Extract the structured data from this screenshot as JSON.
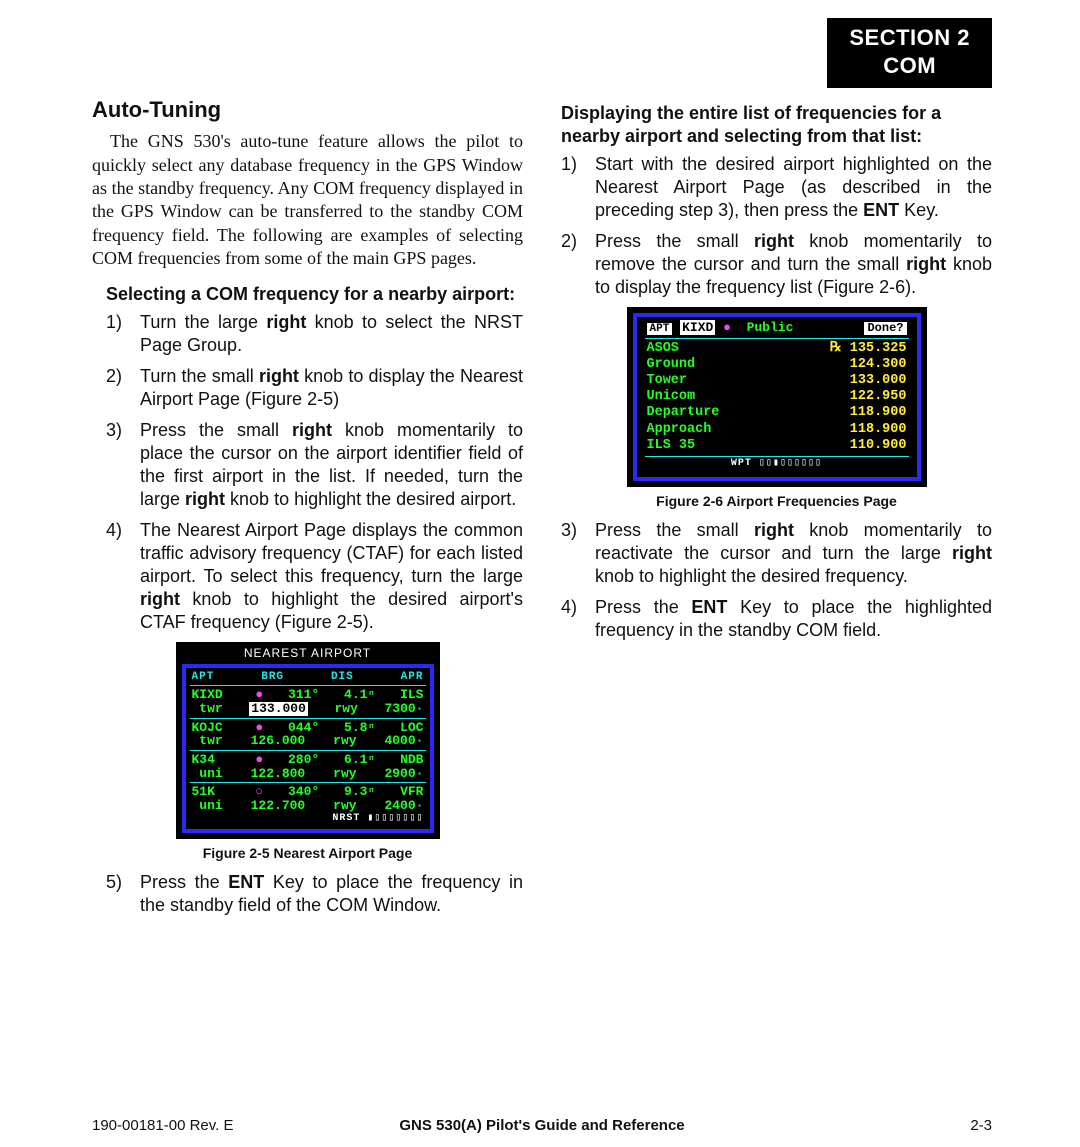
{
  "sectionTab": {
    "line1": "SECTION 2",
    "line2": "COM"
  },
  "col1": {
    "title": "Auto-Tuning",
    "intro": "The GNS 530's auto-tune feature allows the pilot to quickly select any database frequency in the GPS Window as the standby frequency.  Any COM frequency displayed in the GPS Window can be transferred to the standby COM frequency field.  The following are examples of selecting COM frequencies from some of the main GPS pages.",
    "subhead": "Selecting a COM frequency for a nearby airport:",
    "steps": [
      {
        "n": "1)",
        "pre": "Turn the large ",
        "b": "right",
        "post": " knob to select the NRST Page Group."
      },
      {
        "n": "2)",
        "pre": "Turn the small ",
        "b": "right",
        "post": " knob to display the Nearest Airport Page (Figure 2-5)"
      },
      {
        "n": "3)",
        "pre": "Press the small ",
        "b": "right",
        "post": " knob momentarily to place the cursor on the airport identifier field of the first airport in the list.  If needed, turn the large ",
        "b2": "right",
        "post2": " knob to highlight the desired airport."
      },
      {
        "n": "4)",
        "pre": "The Nearest Airport Page displays the common traffic advisory frequency (CTAF) for each listed airport.  To select this frequency, turn the large ",
        "b": "right",
        "post": " knob to highlight the desired airport's CTAF frequency (Figure 2-5)."
      }
    ],
    "step5": {
      "n": "5)",
      "pre": "Press the ",
      "b": "ENT",
      "post": " Key to place the frequency in the standby field of the COM Window."
    }
  },
  "fig1": {
    "title": "NEAREST AIRPORT",
    "headers": [
      "APT",
      "BRG",
      "DIS",
      "APR"
    ],
    "rows": [
      {
        "apt": "KIXD",
        "sym": "●",
        "brg": "311°",
        "dis": "4.1ⁿ",
        "apr": "ILS",
        "lbl": "twr",
        "freqSel": "133.000",
        "rwy": "rwy",
        "rv": "7300·"
      },
      {
        "apt": "KOJC",
        "sym": "●",
        "brg": "044°",
        "dis": "5.8ⁿ",
        "apr": "LOC",
        "lbl": "twr",
        "freq": "126.000",
        "rwy": "rwy",
        "rv": "4000·"
      },
      {
        "apt": "K34",
        "sym": "●",
        "brg": "280°",
        "dis": "6.1ⁿ",
        "apr": "NDB",
        "lbl": "uni",
        "freq": "122.800",
        "rwy": "rwy",
        "rv": "2900·"
      },
      {
        "apt": "51K",
        "sym": "○",
        "brg": "340°",
        "dis": "9.3ⁿ",
        "apr": "VFR",
        "lbl": "uni",
        "freq": "122.700",
        "rwy": "rwy",
        "rv": "2400·"
      }
    ],
    "footer": "NRST ▮▯▯▯▯▯▯▯",
    "caption": "Figure 2-5  Nearest Airport Page"
  },
  "col2": {
    "subhead": "Displaying the entire list of frequencies for a nearby airport and selecting from that list:",
    "stepsA": [
      {
        "n": "1)",
        "pre": "Start with the desired airport highlighted on the Nearest Airport Page (as described in the preceding step 3), then press the ",
        "b": "ENT",
        "post": " Key."
      },
      {
        "n": "2)",
        "pre": "Press the small ",
        "b": "right",
        "post": " knob momentarily to remove the cursor and turn the small ",
        "b2": "right",
        "post2": " knob to display the frequency list (Figure 2-6)."
      }
    ],
    "stepsB": [
      {
        "n": "3)",
        "pre": "Press the small ",
        "b": "right",
        "post": " knob momentarily to reactivate the cursor and turn the large ",
        "b2": "right",
        "post2": " knob to highlight the desired frequency."
      },
      {
        "n": "4)",
        "pre": "Press the ",
        "b": "ENT",
        "post": " Key to place the highlighted frequency in the standby COM field."
      }
    ]
  },
  "fig2": {
    "aptLabel": "APT",
    "ident": "KIXD",
    "sym": "●",
    "type": "Public",
    "done": "Done?",
    "rows": [
      {
        "lab": "ASOS",
        "rx": "℞",
        "val": "135.325"
      },
      {
        "lab": "Ground",
        "val": "124.300"
      },
      {
        "lab": "Tower",
        "val": "133.000"
      },
      {
        "lab": "Unicom",
        "val": "122.950"
      },
      {
        "lab": "Departure",
        "val": "118.900"
      },
      {
        "lab": "Approach",
        "val": "118.900"
      },
      {
        "lab": "ILS 35",
        "val": "110.900"
      }
    ],
    "footer": "WPT ▯▯▮▯▯▯▯▯▯",
    "caption": "Figure 2-6  Airport Frequencies Page"
  },
  "footer": {
    "left": "190-00181-00  Rev. E",
    "center": "GNS 530(A) Pilot's Guide and Reference",
    "right": "2-3"
  },
  "chart_data": [
    {
      "type": "table",
      "title": "Figure 2-5 Nearest Airport Page",
      "columns": [
        "APT",
        "BRG (deg)",
        "DIS (nm)",
        "APR",
        "Freq type",
        "Freq (MHz)",
        "Runway (ft)"
      ],
      "rows": [
        [
          "KIXD",
          311,
          4.1,
          "ILS",
          "twr",
          133.0,
          7300
        ],
        [
          "KOJC",
          44,
          5.8,
          "LOC",
          "twr",
          126.0,
          4000
        ],
        [
          "K34",
          280,
          6.1,
          "NDB",
          "uni",
          122.8,
          2900
        ],
        [
          "51K",
          340,
          9.3,
          "VFR",
          "uni",
          122.7,
          2400
        ]
      ],
      "highlighted_cell": {
        "row": 0,
        "column": "Freq (MHz)",
        "value": 133.0
      }
    },
    {
      "type": "table",
      "title": "Figure 2-6 Airport Frequencies Page — KIXD (Public)",
      "columns": [
        "Service",
        "Freq (MHz)"
      ],
      "rows": [
        [
          "ASOS (Rx)",
          135.325
        ],
        [
          "Ground",
          124.3
        ],
        [
          "Tower",
          133.0
        ],
        [
          "Unicom",
          122.95
        ],
        [
          "Departure",
          118.9
        ],
        [
          "Approach",
          118.9
        ],
        [
          "ILS 35",
          110.9
        ]
      ]
    }
  ]
}
